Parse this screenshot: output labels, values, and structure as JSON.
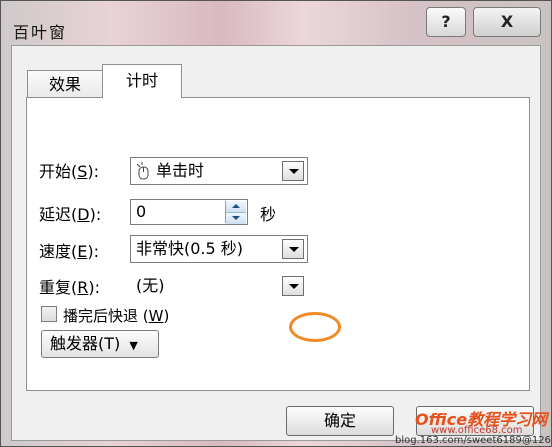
{
  "window": {
    "title": "百叶窗",
    "help_label": "?",
    "close_label": "X"
  },
  "tabs": [
    {
      "label": "效果"
    },
    {
      "label": "计时"
    }
  ],
  "timing": {
    "start_label": "开始(",
    "start_key": "S",
    "start_value": "单击时",
    "delay_label": "延迟(",
    "delay_key": "D",
    "delay_value": "0",
    "delay_unit": "秒",
    "speed_label": "速度(",
    "speed_key": "E",
    "speed_value": "非常快(0.5 秒)",
    "repeat_label": "重复(",
    "repeat_key": "R",
    "repeat_value": "(无)",
    "rewind_label": "播完后快退 (",
    "rewind_key": "W",
    "rewind_checked": false,
    "trigger_label": "触发器(",
    "trigger_key": "T",
    "trigger_arrow": "▼",
    "close_paren_colon": "):",
    "close_paren": ")"
  },
  "buttons": {
    "ok": "确定"
  },
  "watermark": {
    "brand": "Office教程学习网",
    "site": "www.office68.com",
    "blog": "blog.163.com/sweet6189@126"
  },
  "accent_color": "#f08a25"
}
